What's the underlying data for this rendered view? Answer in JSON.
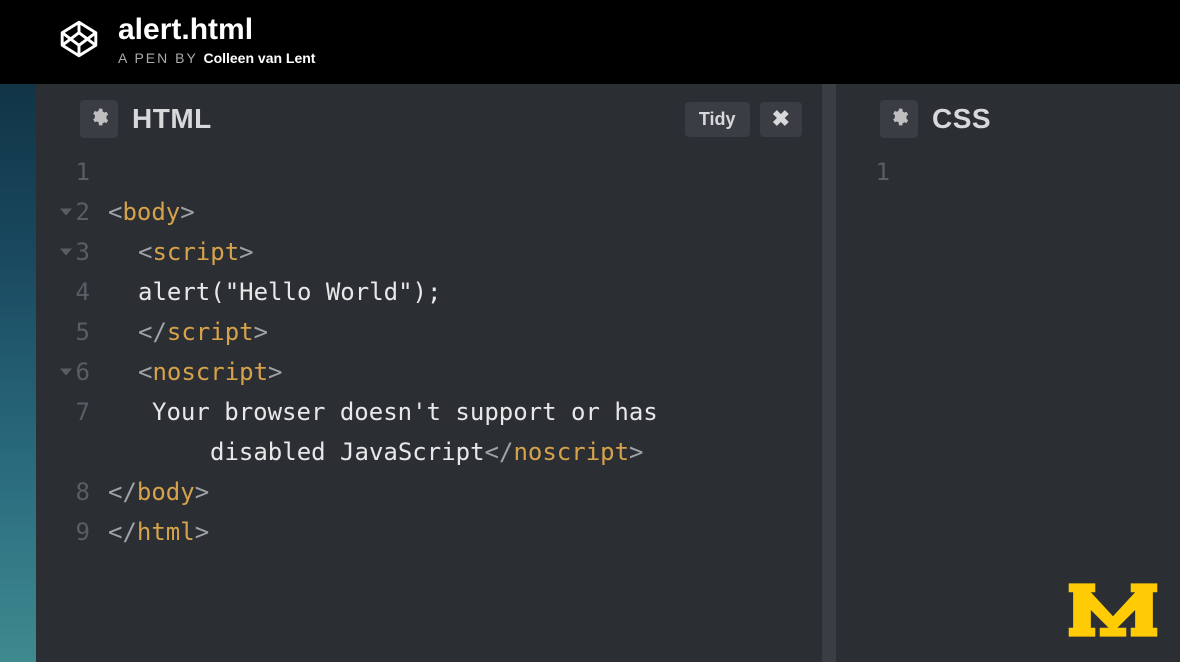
{
  "topbar": {
    "pen_title": "alert.html",
    "byline_prefix": "A PEN BY ",
    "author": "Colleen van Lent"
  },
  "panels": {
    "html": {
      "label": "HTML",
      "tidy_label": "Tidy",
      "close_label": "✖",
      "lines": [
        {
          "num": "1",
          "fold": false,
          "segments": []
        },
        {
          "num": "2",
          "fold": true,
          "segments": [
            {
              "t": "<",
              "c": "tag-bracket"
            },
            {
              "t": "body",
              "c": "tag-name"
            },
            {
              "t": ">",
              "c": "tag-bracket"
            }
          ],
          "indent": 1
        },
        {
          "num": "3",
          "fold": true,
          "segments": [
            {
              "t": "<",
              "c": "tag-bracket"
            },
            {
              "t": "script",
              "c": "tag-name"
            },
            {
              "t": ">",
              "c": "tag-bracket"
            }
          ],
          "indent": 2
        },
        {
          "num": "4",
          "fold": false,
          "segments": [
            {
              "t": "alert(\"Hello World\");",
              "c": "code-plain"
            }
          ],
          "indent": 2
        },
        {
          "num": "5",
          "fold": false,
          "segments": [
            {
              "t": "</",
              "c": "tag-bracket"
            },
            {
              "t": "script",
              "c": "tag-name"
            },
            {
              "t": ">",
              "c": "tag-bracket"
            }
          ],
          "indent": 2
        },
        {
          "num": "6",
          "fold": true,
          "segments": [
            {
              "t": "<",
              "c": "tag-bracket"
            },
            {
              "t": "noscript",
              "c": "tag-name"
            },
            {
              "t": ">",
              "c": "tag-bracket"
            }
          ],
          "indent": 2
        },
        {
          "num": "7",
          "fold": false,
          "segments": [
            {
              "t": "Your browser doesn't support or has",
              "c": "code-plain"
            }
          ],
          "indent": 3
        },
        {
          "num": "",
          "fold": false,
          "segments": [
            {
              "t": "disabled JavaScript",
              "c": "code-plain"
            },
            {
              "t": "</",
              "c": "tag-bracket"
            },
            {
              "t": "noscript",
              "c": "tag-name"
            },
            {
              "t": ">",
              "c": "tag-bracket"
            }
          ],
          "indent": 4
        },
        {
          "num": "8",
          "fold": false,
          "segments": [
            {
              "t": "</",
              "c": "tag-bracket"
            },
            {
              "t": "body",
              "c": "tag-name"
            },
            {
              "t": ">",
              "c": "tag-bracket"
            }
          ],
          "indent": 1
        },
        {
          "num": "9",
          "fold": false,
          "segments": [
            {
              "t": "</",
              "c": "tag-bracket"
            },
            {
              "t": "html",
              "c": "tag-name"
            },
            {
              "t": ">",
              "c": "tag-bracket"
            }
          ],
          "indent": 1
        }
      ]
    },
    "css": {
      "label": "CSS",
      "lines": [
        {
          "num": "1",
          "fold": false,
          "segments": [],
          "indent": 1
        }
      ]
    }
  },
  "icons": {
    "codepen": "codepen-icon",
    "gear": "gear-icon",
    "close": "close-icon",
    "umich": "umich-logo"
  }
}
